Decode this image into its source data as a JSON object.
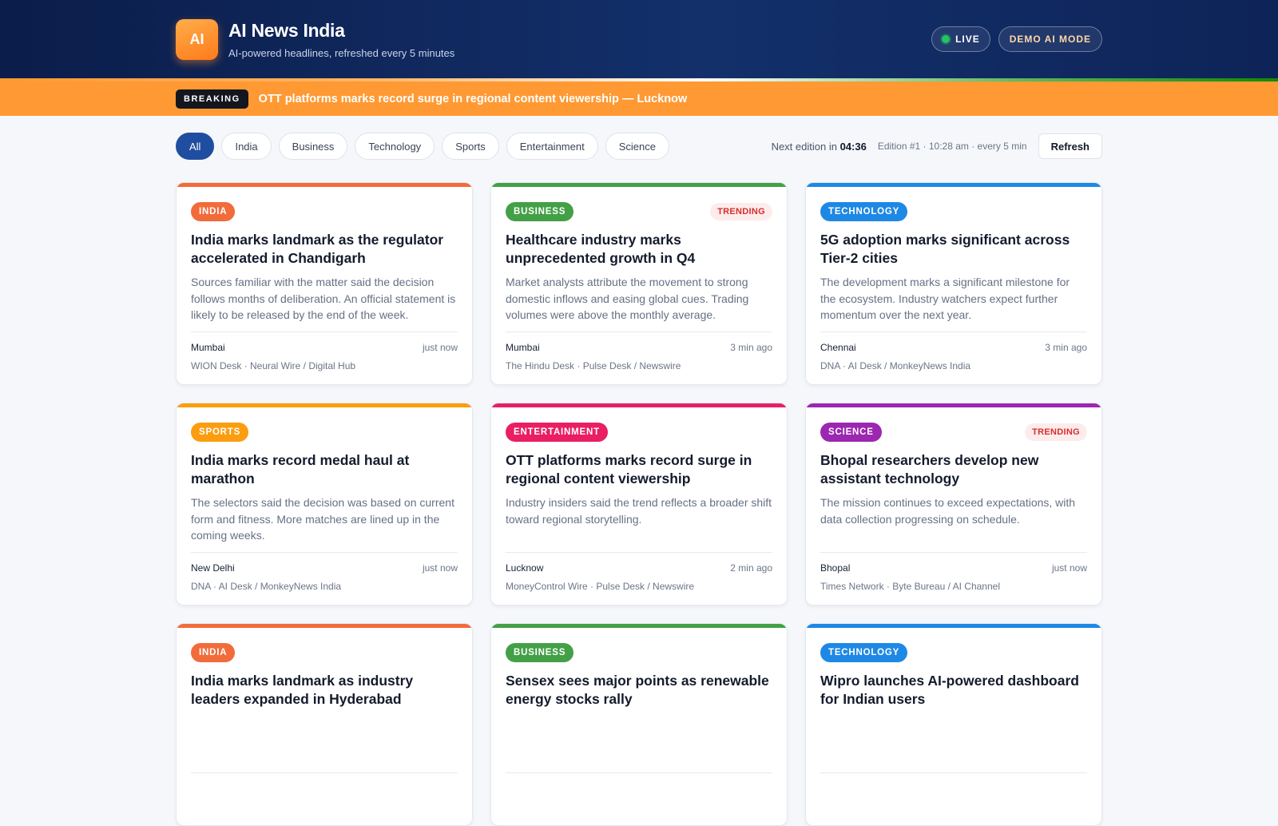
{
  "header": {
    "logo_text": "AI",
    "title": "AI News India",
    "subtitle": "AI-powered headlines, refreshed every 5 minutes",
    "live_label": "LIVE",
    "demo_label": "DEMO AI MODE"
  },
  "breaking": {
    "badge": "BREAKING",
    "text": "OTT platforms marks record surge in regional content viewership — Lucknow"
  },
  "filters": [
    "All",
    "India",
    "Business",
    "Technology",
    "Sports",
    "Entertainment",
    "Science"
  ],
  "active_filter": "All",
  "edition": {
    "next_prefix": "Next edition in ",
    "countdown": "04:36",
    "info": "Edition #1 · 10:28 am · every 5 min",
    "refresh_label": "Refresh"
  },
  "colors": {
    "INDIA": "#f26b3a",
    "BUSINESS": "#43a047",
    "TECHNOLOGY": "#1e88e5",
    "SPORTS": "#fb9d0f",
    "ENTERTAINMENT": "#e91e63",
    "SCIENCE": "#9c27b0"
  },
  "cards": [
    {
      "category": "INDIA",
      "trending": "",
      "title": "India marks landmark as the regulator accelerated in Chandigarh",
      "summary": "Sources familiar with the matter said the decision follows months of deliberation. An official statement is likely to be released by the end of the week.",
      "city": "Mumbai",
      "time": "just now",
      "sources": "WION Desk · Neural Wire / Digital Hub"
    },
    {
      "category": "BUSINESS",
      "trending": "TRENDING",
      "title": "Healthcare industry marks unprecedented growth in Q4",
      "summary": "Market analysts attribute the movement to strong domestic inflows and easing global cues. Trading volumes were above the monthly average.",
      "city": "Mumbai",
      "time": "3 min ago",
      "sources": "The Hindu Desk · Pulse Desk / Newswire"
    },
    {
      "category": "TECHNOLOGY",
      "trending": "",
      "title": "5G adoption marks significant across Tier-2 cities",
      "summary": "The development marks a significant milestone for the ecosystem. Industry watchers expect further momentum over the next year.",
      "city": "Chennai",
      "time": "3 min ago",
      "sources": "DNA · AI Desk / MonkeyNews India"
    },
    {
      "category": "SPORTS",
      "trending": "",
      "title": "India marks record medal haul at marathon",
      "summary": "The selectors said the decision was based on current form and fitness. More matches are lined up in the coming weeks.",
      "city": "New Delhi",
      "time": "just now",
      "sources": "DNA · AI Desk / MonkeyNews India"
    },
    {
      "category": "ENTERTAINMENT",
      "trending": "",
      "title": "OTT platforms marks record surge in regional content viewership",
      "summary": "Industry insiders said the trend reflects a broader shift toward regional storytelling.",
      "city": "Lucknow",
      "time": "2 min ago",
      "sources": "MoneyControl Wire · Pulse Desk / Newswire"
    },
    {
      "category": "SCIENCE",
      "trending": "TRENDING",
      "title": "Bhopal researchers develop new assistant technology",
      "summary": "The mission continues to exceed expectations, with data collection progressing on schedule.",
      "city": "Bhopal",
      "time": "just now",
      "sources": "Times Network · Byte Bureau / AI Channel"
    },
    {
      "category": "INDIA",
      "trending": "",
      "title": "India marks landmark as industry leaders expanded in Hyderabad",
      "summary": "",
      "city": "",
      "time": "",
      "sources": ""
    },
    {
      "category": "BUSINESS",
      "trending": "",
      "title": "Sensex sees major points as renewable energy stocks rally",
      "summary": "",
      "city": "",
      "time": "",
      "sources": ""
    },
    {
      "category": "TECHNOLOGY",
      "trending": "",
      "title": "Wipro launches AI-powered dashboard for Indian users",
      "summary": "",
      "city": "",
      "time": "",
      "sources": ""
    }
  ]
}
